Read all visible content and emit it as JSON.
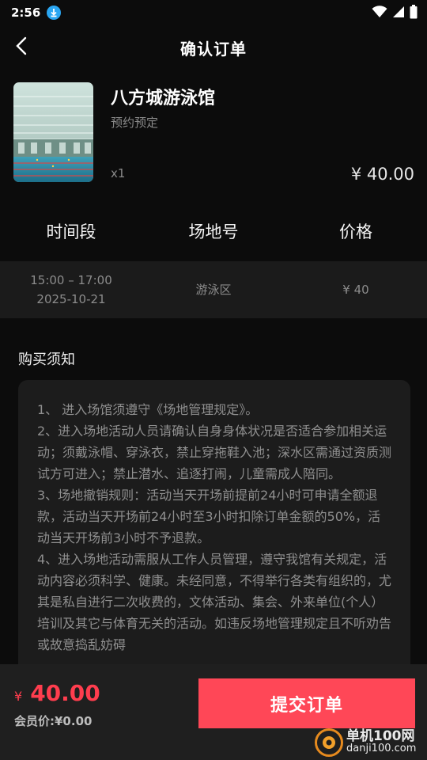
{
  "status_bar": {
    "time": "2:56"
  },
  "nav": {
    "title": "确认订单"
  },
  "product": {
    "name": "八方城游泳馆",
    "booking_type": "预约预定",
    "quantity": "x1",
    "price": "¥ 40.00"
  },
  "table": {
    "headers": [
      "时间段",
      "场地号",
      "价格"
    ],
    "row": {
      "time_range": "15:00 – 17:00",
      "date": "2025-10-21",
      "venue": "游泳区",
      "price": "¥ 40"
    }
  },
  "notes": {
    "title": "购买须知",
    "paragraphs": [
      "1、 进入场馆须遵守《场地管理规定》。",
      "2、进入场地活动人员请确认自身身体状况是否适合参加相关运动；须戴泳帽、穿泳衣，禁止穿拖鞋入池；深水区需通过资质测试方可进入；禁止潜水、追逐打闹，儿童需成人陪同。",
      "3、场地撤销规则：活动当天开场前提前24小时可申请全额退款，活动当天开场前24小时至3小时扣除订单金额的50%，活动当天开场前3小时不予退款。",
      "4、进入场地活动需服从工作人员管理，遵守我馆有关规定，活动内容必须科学、健康。未经同意，不得举行各类有组织的，尤其是私自进行二次收费的，文体活动、集会、外来单位(个人）培训及其它与体育无关的活动。如违反场地管理规定且不听劝告或故意捣乱妨碍"
    ]
  },
  "bottom": {
    "currency": "¥",
    "total": "40.00",
    "member_price": "会员价:¥0.00",
    "submit_label": "提交订单"
  },
  "watermark": {
    "name": "单机100网",
    "url": "danji100.com"
  },
  "colors": {
    "accent": "#ff4757",
    "price_red": "#ff3d4e",
    "background": "#0c0c0c"
  }
}
